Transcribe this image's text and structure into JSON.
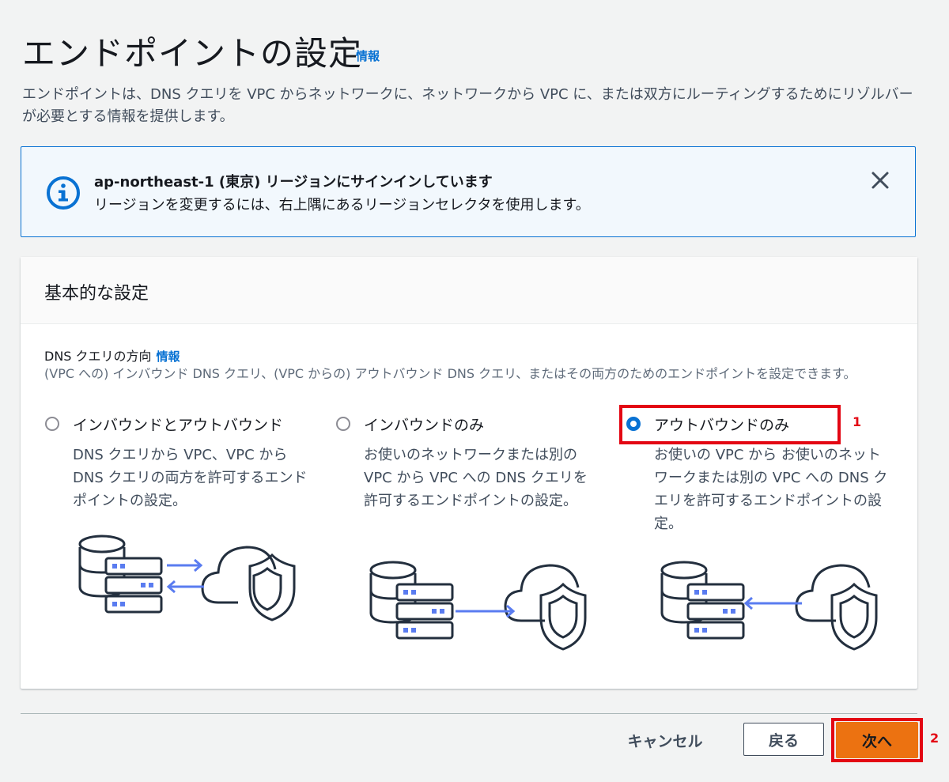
{
  "page": {
    "title": "エンドポイントの設定",
    "title_info": "情報",
    "description": "エンドポイントは、DNS クエリを VPC からネットワークに、ネットワークから VPC に、または双方にルーティングするためにリゾルバーが必要とする情報を提供します。"
  },
  "alert": {
    "icon": "info-circle-icon",
    "title": "ap-northeast-1 (東京) リージョンにサインインしています",
    "body": "リージョンを変更するには、右上隅にあるリージョンセレクタを使用します。",
    "close_icon": "close-icon"
  },
  "panel": {
    "title": "基本的な設定",
    "field_label": "DNS クエリの方向",
    "field_info": "情報",
    "field_description": "(VPC への) インバウンド DNS クエリ、(VPC からの) アウトバウンド DNS クエリ、またはその両方のためのエンドポイントを設定できます。",
    "selected_option": "outbound",
    "options": [
      {
        "id": "inbound-outbound",
        "label": "インバウンドとアウトバウンド",
        "description": "DNS クエリから VPC、VPC から DNS クエリの両方を許可するエンドポイントの設定。",
        "illustration": "bidirectional-arrows"
      },
      {
        "id": "inbound",
        "label": "インバウンドのみ",
        "description": "お使いのネットワークまたは別の VPC から VPC への DNS クエリを許可するエンドポイントの設定。",
        "illustration": "arrow-to-cloud"
      },
      {
        "id": "outbound",
        "label": "アウトバウンドのみ",
        "description": "お使いの VPC から お使いのネットワークまたは別の VPC への DNS クエリを許可するエンドポイントの設定。",
        "illustration": "arrow-to-server"
      }
    ]
  },
  "footer": {
    "cancel_label": "キャンセル",
    "back_label": "戻る",
    "next_label": "次へ"
  },
  "annotations": {
    "marker_1": "1",
    "marker_2": "2"
  },
  "colors": {
    "accent": "#0972d3",
    "primary_button": "#ec7211",
    "annotation": "#e30613",
    "icon_stroke": "#232f3e",
    "diagram_arrow": "#5a7cf0"
  }
}
